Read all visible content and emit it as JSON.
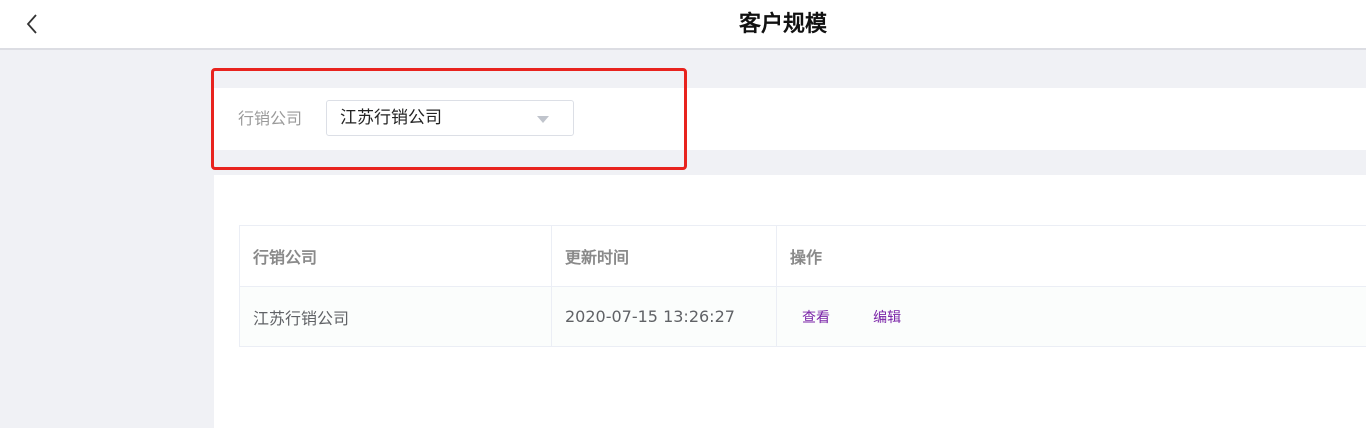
{
  "header": {
    "title": "客户规模",
    "back_icon": "chevron-left-icon"
  },
  "filter": {
    "label": "行销公司",
    "selected": "江苏行销公司",
    "dropdown_icon": "caret-down-icon"
  },
  "table": {
    "columns": [
      "行销公司",
      "更新时间",
      "操作"
    ],
    "rows": [
      {
        "company": "江苏行销公司",
        "updated": "2020-07-15 13:26:27",
        "actions": [
          "查看",
          "编辑"
        ]
      }
    ]
  },
  "colors": {
    "highlight": "#e8231e",
    "link": "#7b25a8"
  }
}
